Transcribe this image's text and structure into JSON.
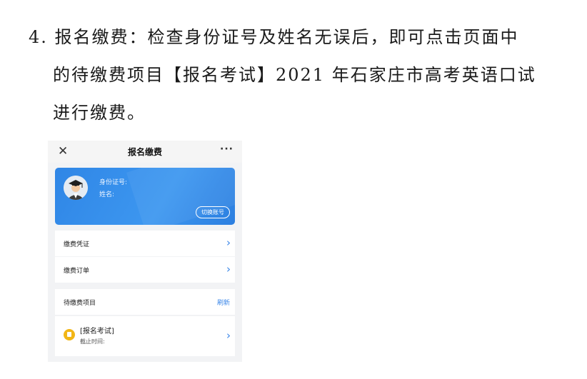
{
  "instruction": {
    "line1": "4. 报名缴费：检查身份证号及姓名无误后，即可点击页面中",
    "line2": "的待缴费项目【报名考试】2021 年石家庄市高考英语口试",
    "line3": "进行缴费。"
  },
  "screenshot": {
    "nav": {
      "close_icon": "close-icon",
      "title": "报名缴费",
      "more_icon": "more-icon"
    },
    "profile": {
      "avatar_icon": "avatar-graduate-icon",
      "id_label": "身份证号:",
      "name_label": "姓名:",
      "switch_button": "切换账号"
    },
    "menu": [
      {
        "label": "缴费凭证",
        "icon": "chevron-right-icon"
      },
      {
        "label": "缴费订单",
        "icon": "chevron-right-icon"
      }
    ],
    "pending": {
      "header": "待缴费项目",
      "refresh": "刷新",
      "item_title": "[报名考试]",
      "item_deadline": "截止时间:",
      "item_icon": "document-icon"
    },
    "colors": {
      "accent": "#3a86e8",
      "card": "#2f86e6",
      "item_icon": "#f2b616"
    }
  }
}
